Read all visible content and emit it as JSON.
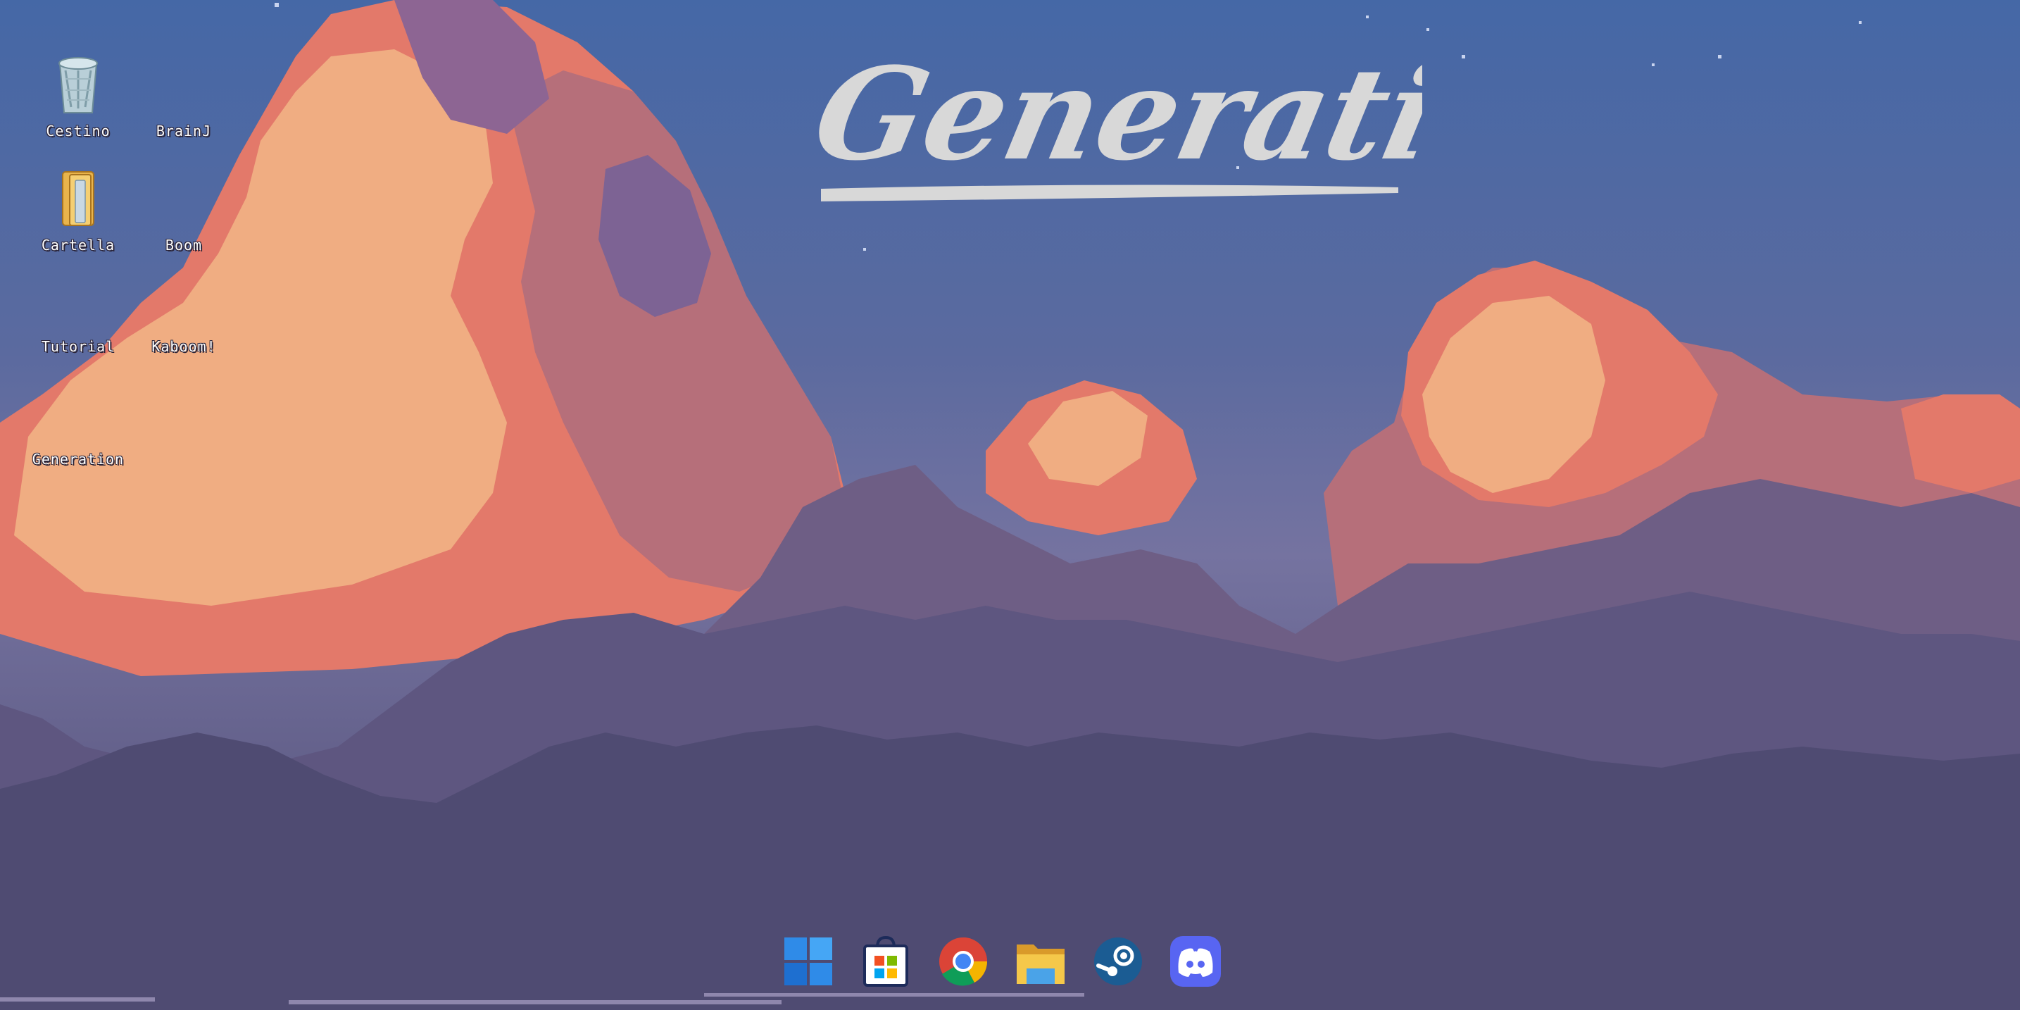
{
  "desktop": {
    "title_logo": "Generation",
    "icons": [
      {
        "label": "Cestino",
        "icon": "recycle-bin-icon"
      },
      {
        "label": "BrainJ",
        "icon": "blank-icon"
      },
      {
        "label": "Cartella",
        "icon": "folder-icon"
      },
      {
        "label": "Boom",
        "icon": "blank-icon"
      },
      {
        "label": "Tutorial",
        "icon": "blank-icon"
      },
      {
        "label": "Kaboom!",
        "icon": "blank-icon"
      },
      {
        "label": "Generation",
        "icon": "blank-icon"
      }
    ]
  },
  "taskbar": {
    "apps": [
      {
        "name": "start-menu",
        "icon": "windows-logo-icon"
      },
      {
        "name": "microsoft-store",
        "icon": "store-bag-icon"
      },
      {
        "name": "chrome",
        "icon": "chrome-icon"
      },
      {
        "name": "file-explorer",
        "icon": "folder-icon"
      },
      {
        "name": "steam",
        "icon": "steam-icon"
      },
      {
        "name": "discord",
        "icon": "discord-icon"
      }
    ]
  },
  "colors": {
    "sky_top": "#4568a6",
    "cloud_light": "#f0ad82",
    "cloud_mid": "#e3796a",
    "cloud_pink": "#b66f7a",
    "cloud_purple": "#6e5e85",
    "cloud_dark": "#4f4b72",
    "logo": "#d8d8d8"
  }
}
